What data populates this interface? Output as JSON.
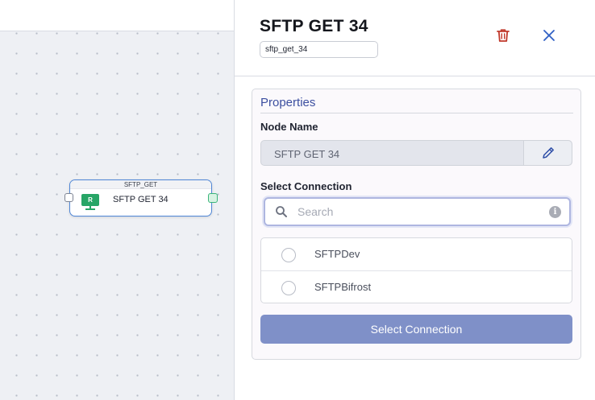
{
  "canvas": {
    "node": {
      "type_label": "SFTP_GET",
      "icon_letter": "R",
      "label": "SFTP GET 34"
    }
  },
  "panel": {
    "title": "SFTP GET 34",
    "id_value": "sftp_get_34",
    "properties": {
      "section_title": "Properties",
      "node_name_label": "Node Name",
      "node_name_value": "SFTP GET 34",
      "select_connection_label": "Select Connection",
      "search_placeholder": "Search",
      "info_icon_glyph": "i",
      "connections": [
        {
          "label": "SFTPDev",
          "selected": false
        },
        {
          "label": "SFTPBifrost",
          "selected": false
        }
      ],
      "submit_label": "Select Connection"
    }
  },
  "colors": {
    "accent": "#3c4fa0",
    "primary_button": "#7f90c8",
    "delete_icon": "#c0392b",
    "close_icon": "#2f5fc4",
    "node_border": "#4f86d6",
    "node_icon": "#27a566"
  },
  "icons": {
    "delete": "trash-icon",
    "close": "close-icon",
    "edit": "pencil-icon",
    "search": "search-icon",
    "info": "info-icon",
    "node": "sftp-node-icon"
  }
}
